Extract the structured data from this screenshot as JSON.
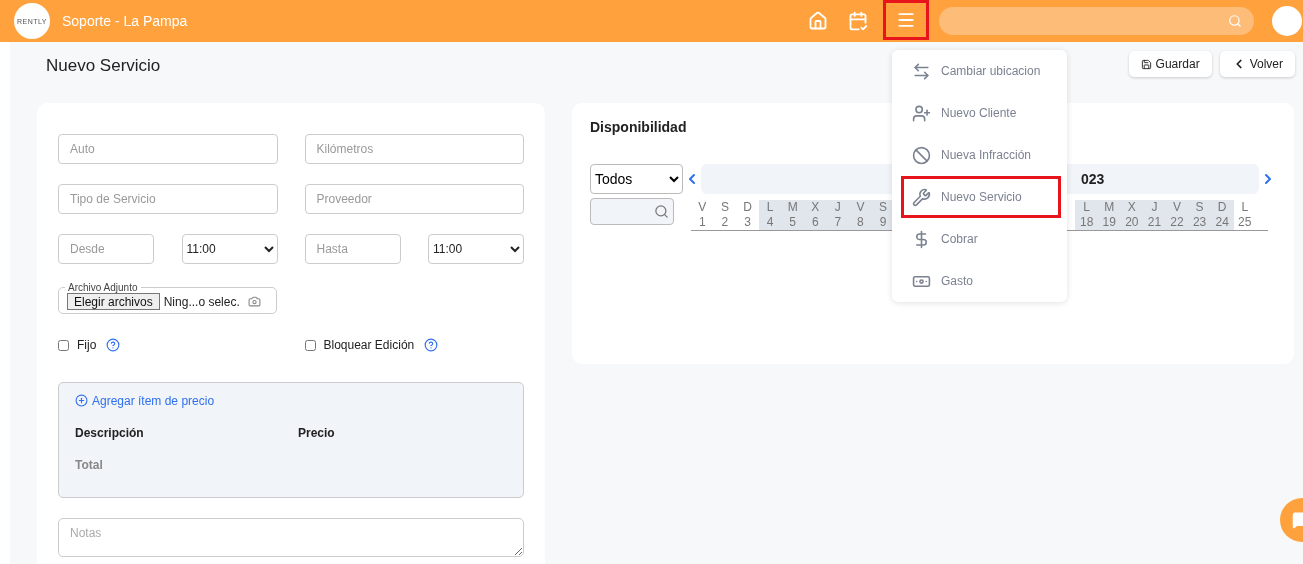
{
  "header": {
    "logo_text": "RENTLY",
    "title": "Soporte - La Pampa",
    "menu_button_highlighted": true
  },
  "page": {
    "title": "Nuevo Servicio",
    "buttons": [
      {
        "label": "Guardar",
        "kind": "save"
      },
      {
        "label": "Volver",
        "kind": "back"
      }
    ]
  },
  "form": {
    "rows": [
      [
        {
          "kind": "input",
          "placeholder": "Auto"
        },
        {
          "kind": "input",
          "placeholder": "Kilómetros"
        }
      ],
      [
        {
          "kind": "input",
          "placeholder": "Tipo de Servicio"
        },
        {
          "kind": "input",
          "placeholder": "Proveedor"
        }
      ],
      [
        {
          "kind": "input",
          "placeholder": "Desde"
        },
        {
          "kind": "select",
          "value": "11:00"
        },
        {
          "kind": "input",
          "placeholder": "Hasta"
        },
        {
          "kind": "select",
          "value": "11:00"
        }
      ]
    ],
    "attachment": {
      "legend": "Archivo Adjunto",
      "button": "Elegir archivos",
      "status": "Ning...o selec."
    },
    "checkboxes": [
      {
        "label": "Fijo",
        "checked": false
      },
      {
        "label": "Bloquear Edición",
        "checked": false
      }
    ],
    "prices": {
      "add_link": "Agregar ítem de precio",
      "columns": [
        "Descripción",
        "Precio"
      ],
      "total_label": "Total"
    },
    "notes": {
      "placeholder": "Notas"
    }
  },
  "availability": {
    "title": "Disponibilidad",
    "filter": {
      "value": "Todos"
    },
    "month_label": "023",
    "day_groups": [
      [
        {
          "weekday": "V",
          "number": "1",
          "highlighted": false
        },
        {
          "weekday": "S",
          "number": "2",
          "highlighted": false
        },
        {
          "weekday": "D",
          "number": "3",
          "highlighted": false
        },
        {
          "weekday": "L",
          "number": "4",
          "highlighted": true
        },
        {
          "weekday": "M",
          "number": "5",
          "highlighted": true
        },
        {
          "weekday": "X",
          "number": "6",
          "highlighted": true
        },
        {
          "weekday": "J",
          "number": "7",
          "highlighted": true
        },
        {
          "weekday": "V",
          "number": "8",
          "highlighted": true
        },
        {
          "weekday": "S",
          "number": "9",
          "highlighted": true
        }
      ],
      [
        {
          "weekday": "L",
          "number": "18",
          "highlighted": true
        },
        {
          "weekday": "M",
          "number": "19",
          "highlighted": true
        },
        {
          "weekday": "X",
          "number": "20",
          "highlighted": true
        },
        {
          "weekday": "J",
          "number": "21",
          "highlighted": true
        },
        {
          "weekday": "V",
          "number": "22",
          "highlighted": true
        },
        {
          "weekday": "S",
          "number": "23",
          "highlighted": true
        },
        {
          "weekday": "D",
          "number": "24",
          "highlighted": true
        },
        {
          "weekday": "L",
          "number": "25",
          "highlighted": false
        }
      ]
    ]
  },
  "dropdown_menu": {
    "items": [
      {
        "label": "Cambiar ubicacion",
        "highlighted": false
      },
      {
        "label": "Nuevo Cliente",
        "highlighted": false
      },
      {
        "label": "Nueva Infracción",
        "highlighted": false
      },
      {
        "label": "Nuevo Servicio",
        "highlighted": true
      },
      {
        "label": "Cobrar",
        "highlighted": false
      },
      {
        "label": "Gasto",
        "highlighted": false
      }
    ]
  }
}
